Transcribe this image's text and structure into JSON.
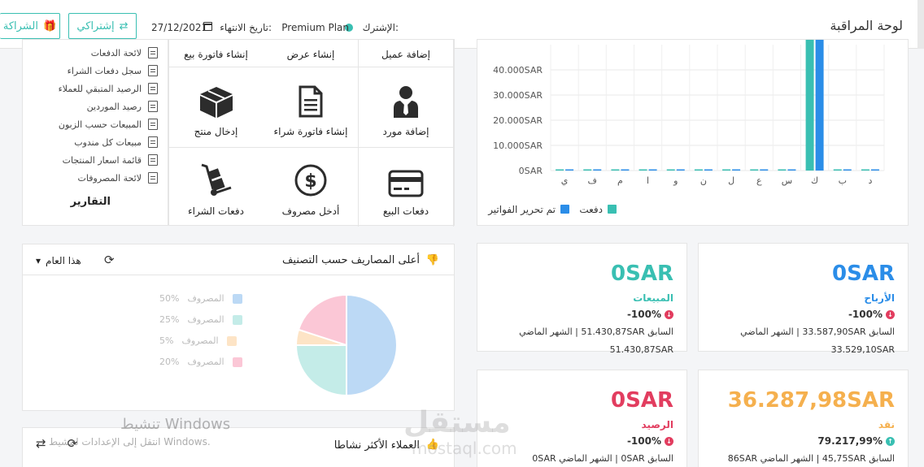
{
  "header": {
    "title": "لوحة المراقبة",
    "plan_label": "الإشترك:",
    "plan_value": "Premium Plan",
    "expiry_label": "تاريخ الانتهاء:",
    "expiry_date": "27/12/2021",
    "subscriptions_button": "إشتراكي",
    "partnership_button": "الشراكة"
  },
  "reports": {
    "title": "التقارير",
    "items": [
      "لائحة الدفعات",
      "سجل دفعات الشراء",
      "الرصيد المتبقي للعملاء",
      "رصيد الموردين",
      "المبيعات حسب الزبون",
      "مبيعات كل مندوب",
      "قائمة اسعار المنتجات",
      "لائحة المصروفات"
    ]
  },
  "shortcuts": [
    {
      "label": "إضافة عميل",
      "icon": "add-customer-icon"
    },
    {
      "label": "إنشاء عرض",
      "icon": "create-quote-icon"
    },
    {
      "label": "إنشاء فاتورة بيع",
      "icon": "sales-invoice-icon"
    },
    {
      "label": "إضافة مورد",
      "icon": "supplier-icon"
    },
    {
      "label": "إنشاء فاتورة شراء",
      "icon": "document-icon"
    },
    {
      "label": "إدخال منتج",
      "icon": "box-icon"
    },
    {
      "label": "دفعات البيع",
      "icon": "credit-card-icon"
    },
    {
      "label": "أدخل مصروف",
      "icon": "dollar-icon"
    },
    {
      "label": "دفعات الشراء",
      "icon": "hand-truck-icon"
    }
  ],
  "chart_data": {
    "type": "bar",
    "categories": [
      "د",
      "ب",
      "ك",
      "س",
      "ع",
      "ل",
      "ن",
      "و",
      "ا",
      "م",
      "ف",
      "ي"
    ],
    "series": [
      {
        "name": "دفعت",
        "color": "#39bfb2",
        "values": [
          0,
          0,
          56000,
          300,
          0,
          0,
          0,
          0,
          0,
          0,
          0,
          0
        ]
      },
      {
        "name": "تم تحرير الفواتير",
        "color": "#2b8de8",
        "values": [
          0,
          0,
          56000,
          300,
          0,
          0,
          0,
          0,
          0,
          0,
          0,
          0
        ]
      }
    ],
    "y_ticks": [
      "0SAR",
      "10.000SAR",
      "20.000SAR",
      "30.000SAR",
      "40.000SAR"
    ],
    "ylim": [
      0,
      50000
    ],
    "grid": true,
    "legend_position": "bottom-right"
  },
  "expenses_card": {
    "title": "أعلى المصاريف حسب التصنيف",
    "period": "هذا العام",
    "legend": [
      {
        "label": "المصروف",
        "pct": "50%",
        "color": "#bcd9f5"
      },
      {
        "label": "المصروف",
        "pct": "25%",
        "color": "#c4ece8"
      },
      {
        "label": "المصروف",
        "pct": "5%",
        "color": "#fde4c6"
      },
      {
        "label": "المصروف",
        "pct": "20%",
        "color": "#fbc7d6"
      }
    ],
    "pie_values": [
      50,
      25,
      5,
      20
    ]
  },
  "active_customers": {
    "title": "العملاء الأكثر نشاطا"
  },
  "stats": {
    "profit": {
      "value": "0SAR",
      "label": "الأرباح",
      "change": "-100%",
      "prev": "السابق 33.587,90SAR | الشهر الماضي",
      "extra": "33.529,10SAR",
      "color": "#2b8de8"
    },
    "sales": {
      "value": "0SAR",
      "label": "المبيعات",
      "change": "-100%",
      "prev": "السابق 51.430,87SAR | الشهر الماضي",
      "extra": "51.430,87SAR",
      "color": "#39bfb2"
    },
    "cash": {
      "value": "36.287,98SAR",
      "label": "نقد",
      "change": "79.217,99%",
      "prev": "السابق 45,75SAR | الشهر الماضي 86SAR",
      "color": "#f5b04e"
    },
    "balance": {
      "value": "0SAR",
      "label": "الرصيد",
      "change": "-100%",
      "prev": "السابق 0SAR | الشهر الماضي 0SAR",
      "color": "#e23d5f"
    }
  },
  "watermarks": {
    "windows_title": "تنشيط Windows",
    "windows_hint": "انتقل إلى الإعدادات لتنشيط Windows.",
    "brand": "مستقل",
    "brand_url": "mostaql.com"
  }
}
